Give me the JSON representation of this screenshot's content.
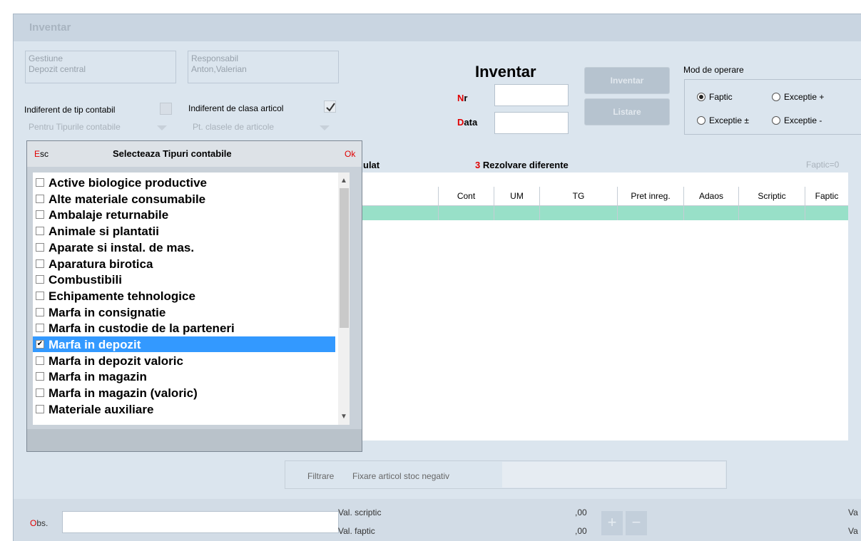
{
  "window": {
    "title": "Inventar"
  },
  "info": {
    "gestiune_label": "Gestiune",
    "gestiune_value": "Depozit central",
    "responsabil_label": "Responsabil",
    "responsabil_value": "Anton,Valerian"
  },
  "filters": {
    "tip_contabil_label": "Indiferent de tip contabil",
    "tip_contabil_checked": false,
    "clasa_articol_label": "Indiferent de clasa articol",
    "clasa_articol_checked": true,
    "tipuri_dropdown": "Pentru Tipurile contabile",
    "clase_dropdown": "Pt. clasele de articole"
  },
  "document": {
    "title": "Inventar",
    "nr_label_first": "N",
    "nr_label_rest": "r",
    "data_label_first": "D",
    "data_label_rest": "ata",
    "nr_value": "",
    "data_value": ""
  },
  "buttons": {
    "inventar": "Inventar",
    "listare": "Listare"
  },
  "mode": {
    "title": "Mod de operare",
    "options": [
      "Faptic",
      "Exceptie +",
      "Exceptie ±",
      "Exceptie -"
    ],
    "selected": "Faptic"
  },
  "tabs": {
    "tab2_partial": "ulat",
    "tab3_number": "3",
    "tab3_label": "Rezolvare diferente",
    "faptic_filter": "Faptic=0"
  },
  "grid": {
    "columns": [
      "Cont",
      "UM",
      "TG",
      "Pret inreg.",
      "Adaos",
      "Scriptic",
      "Faptic"
    ]
  },
  "popup": {
    "esc_first": "E",
    "esc_rest": "sc",
    "title": "Selecteaza Tipuri contabile",
    "ok_label": "Ok",
    "items": [
      {
        "label": "Active biologice productive",
        "checked": false
      },
      {
        "label": "Alte materiale consumabile",
        "checked": false
      },
      {
        "label": "Ambalaje returnabile",
        "checked": false
      },
      {
        "label": "Animale si plantatii",
        "checked": false
      },
      {
        "label": "Aparate si instal. de mas.",
        "checked": false
      },
      {
        "label": "Aparatura birotica",
        "checked": false
      },
      {
        "label": "Combustibili",
        "checked": false
      },
      {
        "label": "Echipamente tehnologice",
        "checked": false
      },
      {
        "label": "Marfa in consignatie",
        "checked": false
      },
      {
        "label": "Marfa in custodie de la parteneri",
        "checked": false
      },
      {
        "label": "Marfa in depozit",
        "checked": true
      },
      {
        "label": "Marfa in depozit valoric",
        "checked": false
      },
      {
        "label": "Marfa in magazin",
        "checked": false
      },
      {
        "label": "Marfa in magazin (valoric)",
        "checked": false
      },
      {
        "label": "Materiale auxiliare",
        "checked": false
      }
    ]
  },
  "footer": {
    "filtrare": "Filtrare",
    "fixare": "Fixare articol stoc negativ",
    "obs_first": "O",
    "obs_rest": "bs.",
    "val_scriptic_label": "Val. scriptic",
    "val_scriptic_value": ",00",
    "val_faptic_label": "Val. faptic",
    "val_faptic_value": ",00",
    "right_cut_1": "Va",
    "right_cut_2": "Va"
  },
  "colors": {
    "accent_red": "#e00000",
    "selection": "#3399ff",
    "green_row": "#98e0c8"
  }
}
